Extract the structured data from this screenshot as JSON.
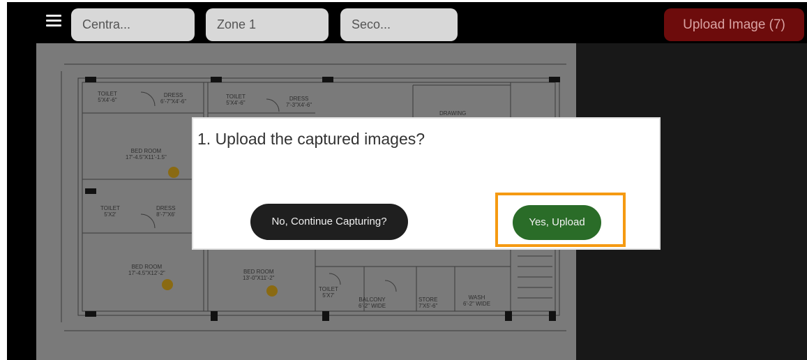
{
  "toolbar": {
    "filters": [
      "Centra...",
      "Zone 1",
      "Seco..."
    ],
    "upload_button_label": "Upload Image (7)"
  },
  "floor_plan": {
    "room_labels": [
      "TOILET\n5'X4'-6\"",
      "DRESS\n6'-7\"X4'-6\"",
      "TOILET\n5'X4'-6\"",
      "DRESS\n7'-3\"X4'-6\"",
      "DRAWING",
      "BED ROOM\n17'-4.5\"X11'-1.5\"",
      "TOILET\n5'X2'",
      "DRESS\n8'-7\"X6'",
      "BED ROOM\n17'-4.5\"X12'-2\"",
      "BED ROOM\n13'-0\"X11'-2\"",
      "TOILET\n5'X7'",
      "BALCONY\n6'-2\" WIDE",
      "STORE\n7'X5'-6\"",
      "WASH\n6'-2\" WIDE"
    ]
  },
  "dialog": {
    "message": "1. Upload the captured images?",
    "no_button_label": "No, Continue Capturing?",
    "yes_button_label": "Yes, Upload"
  },
  "colors": {
    "upload_button": "#6d0c0c",
    "yes_button": "#2a6c28",
    "no_button": "#1f1f1f",
    "highlight_border": "#f59a12",
    "marker": "#8a6a12"
  }
}
